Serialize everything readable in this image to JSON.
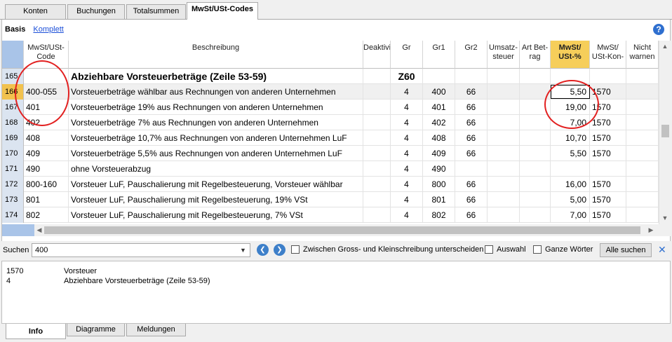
{
  "tabs": [
    "Konten",
    "Buchungen",
    "Totalsummen",
    "MwSt/USt-Codes"
  ],
  "view": {
    "basis": "Basis",
    "komplett": "Komplett",
    "help": "?"
  },
  "headers": {
    "code": "MwSt/USt-\nCode",
    "desc": "Beschreibung",
    "deakt": "Deaktivie-",
    "gr": "Gr",
    "gr1": "Gr1",
    "gr2": "Gr2",
    "umsatz": "Umsatz-\nsteuer",
    "artbetrag": "Art Bet-\nrag",
    "mwst": "MwSt/\nUSt-%",
    "konto": "MwSt/\nUSt-Kon-",
    "nicht": "Nicht\nwarnen"
  },
  "rows": [
    {
      "n": "165",
      "code": "",
      "desc": "Abziehbare Vorsteuerbeträge (Zeile 53-59)",
      "gr": "Z60",
      "gr1": "",
      "gr2": "",
      "pct": "",
      "konto": ""
    },
    {
      "n": "166",
      "code": "400-055",
      "desc": "Vorsteuerbeträge wählbar aus Rechnungen von anderen Unternehmen",
      "gr": "4",
      "gr1": "400",
      "gr2": "66",
      "pct": "5,50",
      "konto": "1570"
    },
    {
      "n": "167",
      "code": "401",
      "desc": "Vorsteuerbeträge 19% aus Rechnungen von anderen Unternehmen",
      "gr": "4",
      "gr1": "401",
      "gr2": "66",
      "pct": "19,00",
      "konto": "1570"
    },
    {
      "n": "168",
      "code": "402",
      "desc": "Vorsteuerbeträge 7% aus Rechnungen von anderen Unternehmen",
      "gr": "4",
      "gr1": "402",
      "gr2": "66",
      "pct": "7,00",
      "konto": "1570"
    },
    {
      "n": "169",
      "code": "408",
      "desc": "Vorsteuerbeträge 10,7% aus Rechnungen von anderen Unternehmen LuF",
      "gr": "4",
      "gr1": "408",
      "gr2": "66",
      "pct": "10,70",
      "konto": "1570"
    },
    {
      "n": "170",
      "code": "409",
      "desc": "Vorsteuerbeträge 5,5% aus Rechnungen von anderen Unternehmen LuF",
      "gr": "4",
      "gr1": "409",
      "gr2": "66",
      "pct": "5,50",
      "konto": "1570"
    },
    {
      "n": "171",
      "code": "490",
      "desc": "ohne Vorsteuerabzug",
      "gr": "4",
      "gr1": "490",
      "gr2": "",
      "pct": "",
      "konto": ""
    },
    {
      "n": "172",
      "code": "800-160",
      "desc": "Vorsteuer LuF, Pauschalierung mit Regelbesteuerung, Vorsteuer wählbar",
      "gr": "4",
      "gr1": "800",
      "gr2": "66",
      "pct": "16,00",
      "konto": "1570"
    },
    {
      "n": "173",
      "code": "801",
      "desc": "Vorsteuer LuF, Pauschalierung mit Regelbesteuerung, 19% VSt",
      "gr": "4",
      "gr1": "801",
      "gr2": "66",
      "pct": "5,00",
      "konto": "1570"
    },
    {
      "n": "174",
      "code": "802",
      "desc": "Vorsteuer LuF, Pauschalierung mit Regelbesteuerung, 7% VSt",
      "gr": "4",
      "gr1": "802",
      "gr2": "66",
      "pct": "7,00",
      "konto": "1570"
    }
  ],
  "search": {
    "label": "Suchen",
    "value": "400",
    "case_label": "Zwischen Gross- und Kleinschreibung unterscheiden",
    "auswahl_label": "Auswahl",
    "ganze_label": "Ganze Wörter",
    "all_button": "Alle suchen"
  },
  "info": [
    {
      "a": "1570",
      "b": "Vorsteuer"
    },
    {
      "a": "4",
      "b": "Abziehbare Vorsteuerbeträge (Zeile 53-59)"
    }
  ],
  "bottom_tabs": [
    "Info",
    "Diagramme",
    "Meldungen"
  ],
  "colors": {
    "accent": "#f6ce5a",
    "annotation": "#e22020"
  }
}
